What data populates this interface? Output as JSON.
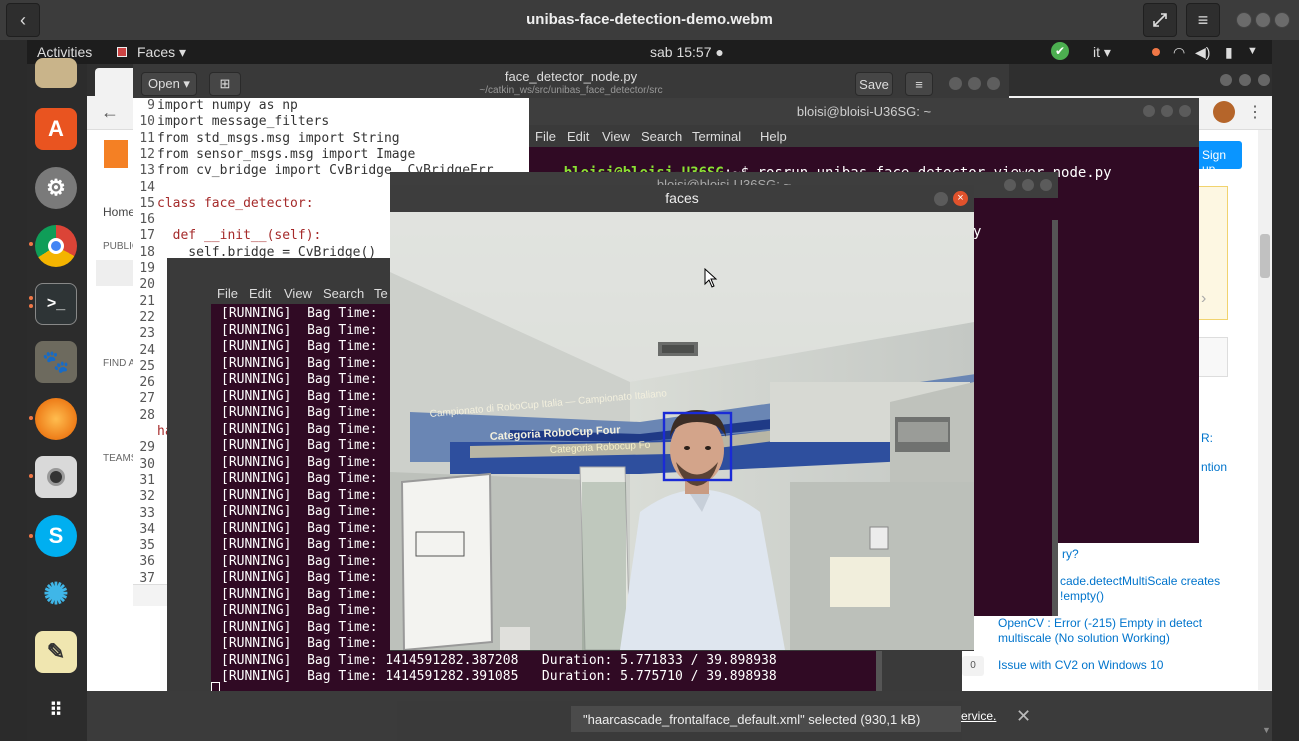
{
  "player": {
    "title": "unibas-face-detection-demo.webm",
    "back_icon": "chevron-left-icon",
    "expand_icon": "expand-icon",
    "menu_icon": "hamburger-icon"
  },
  "topbar": {
    "activities": "Activities",
    "app_menu": "Faces ▾",
    "clock": "sab 15:57 ●",
    "lang": "it ▾"
  },
  "browser": {
    "sign_up": "Sign up",
    "left_nav": [
      "Home",
      "PUBLIC",
      "FIND A",
      "TEAMS"
    ],
    "related": [
      {
        "count": "",
        "text": "cade.detectMultiScale creates\n!empty()"
      },
      {
        "count": "",
        "text": "OpenCV : Error (-215) Empty in detect\nmultiscale (No solution Working)"
      },
      {
        "count": "0",
        "text": "Issue with CV2 on Windows 10"
      }
    ],
    "side_snips": [
      "R:",
      "ntion",
      "ry?"
    ]
  },
  "gedit": {
    "open_label": "Open ▾",
    "title": "face_detector_node.py",
    "path": "~/catkin_ws/src/unibas_face_detector/src",
    "save_label": "Save",
    "lines": [
      {
        "n": "9",
        "t": "import numpy as np"
      },
      {
        "n": "10",
        "t": "import message_filters"
      },
      {
        "n": "11",
        "t": "from std_msgs.msg import String"
      },
      {
        "n": "12",
        "t": "from sensor_msgs.msg import Image"
      },
      {
        "n": "13",
        "t": "from cv_bridge import CvBridge, CvBridgeErr"
      },
      {
        "n": "14",
        "t": ""
      },
      {
        "n": "15",
        "t": "class face_detector:"
      },
      {
        "n": "16",
        "t": ""
      },
      {
        "n": "17",
        "t": "  def __init__(self):"
      },
      {
        "n": "18",
        "t": "    self.bridge = CvBridge()"
      },
      {
        "n": "19",
        "t": ""
      },
      {
        "n": "20",
        "t": "    sel"
      },
      {
        "n": "21",
        "t": ""
      },
      {
        "n": "22",
        "t": "    sel"
      },
      {
        "n": "23",
        "t": ""
      },
      {
        "n": "24",
        "t": "  def c"
      },
      {
        "n": "25",
        "t": ""
      },
      {
        "n": "26",
        "t": "    try"
      },
      {
        "n": "27",
        "t": "      t"
      },
      {
        "n": "28",
        "t": "      f"
      },
      {
        "n": "",
        "t": "haarcas"
      },
      {
        "n": "29",
        "t": "      g"
      },
      {
        "n": "30",
        "t": "      f"
      },
      {
        "n": "31",
        "t": "      f"
      },
      {
        "n": "32",
        "t": ""
      },
      {
        "n": "33",
        "t": ""
      },
      {
        "n": "34",
        "t": ""
      },
      {
        "n": "35",
        "t": ""
      },
      {
        "n": "36",
        "t": "    exc"
      },
      {
        "n": "37",
        "t": ""
      }
    ]
  },
  "term_viewer": {
    "title": "bloisi@bloisi-U36SG: ~",
    "menu": [
      "File",
      "Edit",
      "View",
      "Search",
      "Terminal",
      "Help"
    ],
    "prompt_user": "bloisi@bloisi-U36SG",
    "prompt_rest": ":~$ rosrun unibas_face_detector viewer_node.py",
    "snippet": "y"
  },
  "term_bag": {
    "menu": [
      "File",
      "Edit",
      "View",
      "Search",
      "Te"
    ],
    "running_rows": 21,
    "row_text": "[RUNNING]  Bag Time:",
    "last_rows": [
      "[RUNNING]  Bag Time: 1414591282.387208   Duration: 5.771833 / 39.898938",
      "[RUNNING]  Bag Time: 1414591282.391085   Duration: 5.775710 / 39.898938"
    ]
  },
  "back_term_title": "bloisi@bloisi-U36SG: ~",
  "faces": {
    "title": "faces",
    "banner1": "Campionato di RoboCup Italia — Campionato Italiano",
    "banner2": "Categoria RoboCup Four",
    "banner3": "Categoria Robocup Fo"
  },
  "download": {
    "text": "\"haarcascade_frontalface_default.xml\" selected  (930,1 kB)",
    "service": "ervice."
  },
  "colors": {
    "terminal_bg": "#300a24",
    "prompt_green": "#8ae234",
    "face_box": "#1a2bd6"
  }
}
